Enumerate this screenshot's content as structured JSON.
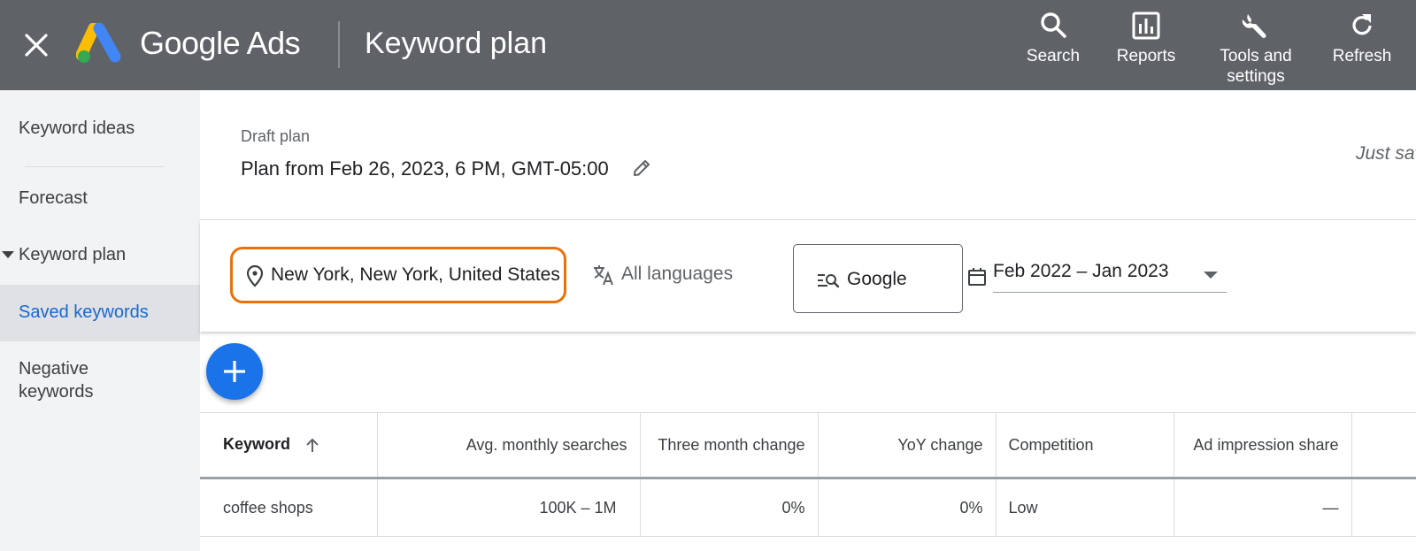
{
  "header": {
    "close_icon": "close-icon",
    "logo_icon": "google-ads-logo",
    "brand_google": "Google",
    "brand_ads": "Ads",
    "title": "Keyword plan",
    "actions": [
      {
        "label": "Search",
        "icon": "search-icon"
      },
      {
        "label": "Reports",
        "icon": "bar-chart-icon"
      },
      {
        "label": "Tools and settings",
        "icon": "wrench-icon"
      },
      {
        "label": "Refresh",
        "icon": "refresh-icon"
      }
    ]
  },
  "sidebar": {
    "items": [
      {
        "label": "Keyword ideas"
      },
      {
        "label": "Forecast"
      },
      {
        "label": "Keyword plan"
      },
      {
        "label": "Saved keywords",
        "active": true
      },
      {
        "label": "Negative keywords"
      }
    ]
  },
  "plan": {
    "draft_label": "Draft plan",
    "name": "Plan from Feb 26, 2023, 6 PM, GMT-05:00",
    "saved_status": "Just saved"
  },
  "filters": {
    "location": "New York, New York, United States",
    "language": "All languages",
    "network": "Google",
    "date_range": "Feb 2022 – Jan 2023"
  },
  "table": {
    "columns": [
      "Keyword",
      "Avg. monthly searches",
      "Three month change",
      "YoY change",
      "Competition",
      "Ad impression share"
    ],
    "rows": [
      [
        "coffee shops",
        "100K – 1M",
        "0%",
        "0%",
        "Low",
        "—"
      ]
    ]
  },
  "colors": {
    "topbar": "#5f6368",
    "accent_blue": "#1a73e8",
    "highlight_orange": "#e8710a"
  }
}
